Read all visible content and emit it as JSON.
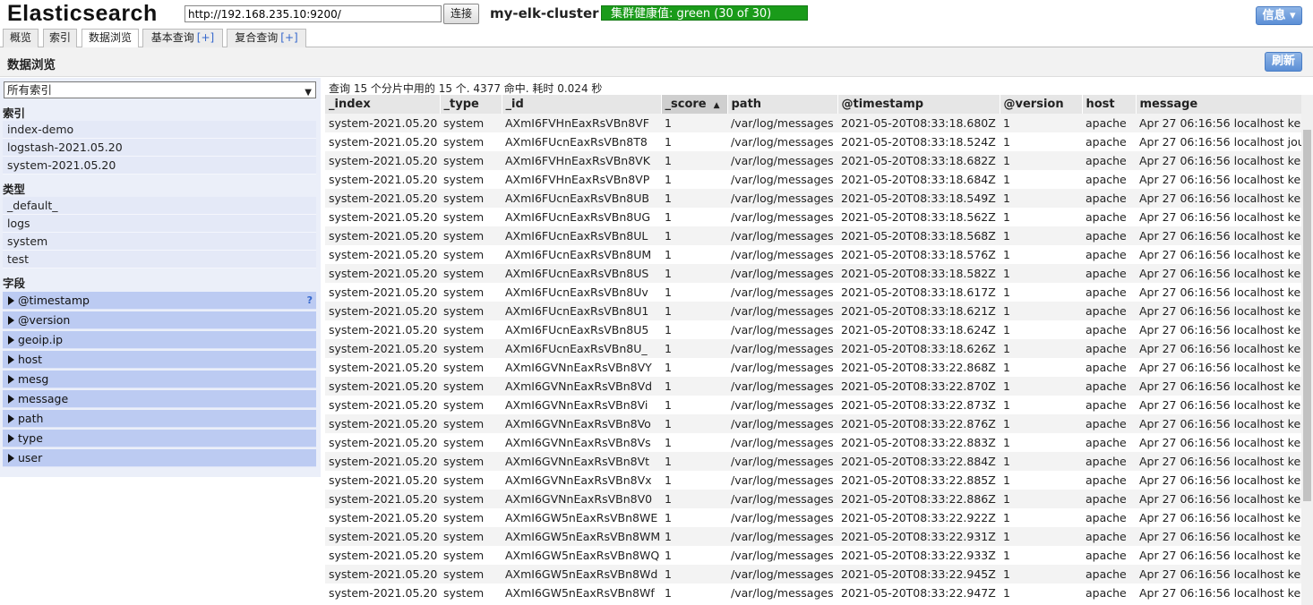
{
  "header": {
    "logo": "Elasticsearch",
    "url_value": "http://192.168.235.10:9200/",
    "connect_label": "连接",
    "cluster_name": "my-elk-cluster",
    "health_text": "集群健康值: green (30 of 30)",
    "health_color": "#1a9b1a",
    "info_label": "信息 ▾"
  },
  "tabs": [
    {
      "label": "概览",
      "plus": ""
    },
    {
      "label": "索引",
      "plus": ""
    },
    {
      "label": "数据浏览",
      "plus": "",
      "active": true
    },
    {
      "label": "基本查询",
      "plus": "[+]"
    },
    {
      "label": "复合查询",
      "plus": "[+]"
    }
  ],
  "section": {
    "title": "数据浏览",
    "refresh_label": "刷新"
  },
  "sidebar": {
    "index_select": "所有索引",
    "indices_heading": "索引",
    "indices": [
      "index-demo",
      "logstash-2021.05.20",
      "system-2021.05.20"
    ],
    "types_heading": "类型",
    "types": [
      "_default_",
      "logs",
      "system",
      "test"
    ],
    "fields_heading": "字段",
    "fields": [
      "@timestamp",
      "@version",
      "geoip.ip",
      "host",
      "mesg",
      "message",
      "path",
      "type",
      "user"
    ],
    "help_mark": "?"
  },
  "results": {
    "summary": "查询 15 个分片中用的 15 个. 4377 命中. 耗时 0.024 秒",
    "columns": [
      "_index",
      "_type",
      "_id",
      "_score",
      "path",
      "@timestamp",
      "@version",
      "host",
      "message"
    ],
    "sort_indicator": "▲",
    "rows": [
      [
        "system-2021.05.20",
        "system",
        "AXmI6FVHnEaxRsVBn8VF",
        "1",
        "/var/log/messages",
        "2021-05-20T08:33:18.680Z",
        "1",
        "apache",
        "Apr 27 06:16:56 localhost ke"
      ],
      [
        "system-2021.05.20",
        "system",
        "AXmI6FUcnEaxRsVBn8T8",
        "1",
        "/var/log/messages",
        "2021-05-20T08:33:18.524Z",
        "1",
        "apache",
        "Apr 27 06:16:56 localhost jou"
      ],
      [
        "system-2021.05.20",
        "system",
        "AXmI6FVHnEaxRsVBn8VK",
        "1",
        "/var/log/messages",
        "2021-05-20T08:33:18.682Z",
        "1",
        "apache",
        "Apr 27 06:16:56 localhost ke"
      ],
      [
        "system-2021.05.20",
        "system",
        "AXmI6FVHnEaxRsVBn8VP",
        "1",
        "/var/log/messages",
        "2021-05-20T08:33:18.684Z",
        "1",
        "apache",
        "Apr 27 06:16:56 localhost ke"
      ],
      [
        "system-2021.05.20",
        "system",
        "AXmI6FUcnEaxRsVBn8UB",
        "1",
        "/var/log/messages",
        "2021-05-20T08:33:18.549Z",
        "1",
        "apache",
        "Apr 27 06:16:56 localhost ke"
      ],
      [
        "system-2021.05.20",
        "system",
        "AXmI6FUcnEaxRsVBn8UG",
        "1",
        "/var/log/messages",
        "2021-05-20T08:33:18.562Z",
        "1",
        "apache",
        "Apr 27 06:16:56 localhost ke"
      ],
      [
        "system-2021.05.20",
        "system",
        "AXmI6FUcnEaxRsVBn8UL",
        "1",
        "/var/log/messages",
        "2021-05-20T08:33:18.568Z",
        "1",
        "apache",
        "Apr 27 06:16:56 localhost ke"
      ],
      [
        "system-2021.05.20",
        "system",
        "AXmI6FUcnEaxRsVBn8UM",
        "1",
        "/var/log/messages",
        "2021-05-20T08:33:18.576Z",
        "1",
        "apache",
        "Apr 27 06:16:56 localhost ke"
      ],
      [
        "system-2021.05.20",
        "system",
        "AXmI6FUcnEaxRsVBn8US",
        "1",
        "/var/log/messages",
        "2021-05-20T08:33:18.582Z",
        "1",
        "apache",
        "Apr 27 06:16:56 localhost ke"
      ],
      [
        "system-2021.05.20",
        "system",
        "AXmI6FUcnEaxRsVBn8Uv",
        "1",
        "/var/log/messages",
        "2021-05-20T08:33:18.617Z",
        "1",
        "apache",
        "Apr 27 06:16:56 localhost ke"
      ],
      [
        "system-2021.05.20",
        "system",
        "AXmI6FUcnEaxRsVBn8U1",
        "1",
        "/var/log/messages",
        "2021-05-20T08:33:18.621Z",
        "1",
        "apache",
        "Apr 27 06:16:56 localhost ke"
      ],
      [
        "system-2021.05.20",
        "system",
        "AXmI6FUcnEaxRsVBn8U5",
        "1",
        "/var/log/messages",
        "2021-05-20T08:33:18.624Z",
        "1",
        "apache",
        "Apr 27 06:16:56 localhost ke"
      ],
      [
        "system-2021.05.20",
        "system",
        "AXmI6FUcnEaxRsVBn8U_",
        "1",
        "/var/log/messages",
        "2021-05-20T08:33:18.626Z",
        "1",
        "apache",
        "Apr 27 06:16:56 localhost ke"
      ],
      [
        "system-2021.05.20",
        "system",
        "AXmI6GVNnEaxRsVBn8VY",
        "1",
        "/var/log/messages",
        "2021-05-20T08:33:22.868Z",
        "1",
        "apache",
        "Apr 27 06:16:56 localhost ke"
      ],
      [
        "system-2021.05.20",
        "system",
        "AXmI6GVNnEaxRsVBn8Vd",
        "1",
        "/var/log/messages",
        "2021-05-20T08:33:22.870Z",
        "1",
        "apache",
        "Apr 27 06:16:56 localhost ke"
      ],
      [
        "system-2021.05.20",
        "system",
        "AXmI6GVNnEaxRsVBn8Vi",
        "1",
        "/var/log/messages",
        "2021-05-20T08:33:22.873Z",
        "1",
        "apache",
        "Apr 27 06:16:56 localhost ke"
      ],
      [
        "system-2021.05.20",
        "system",
        "AXmI6GVNnEaxRsVBn8Vo",
        "1",
        "/var/log/messages",
        "2021-05-20T08:33:22.876Z",
        "1",
        "apache",
        "Apr 27 06:16:56 localhost ke"
      ],
      [
        "system-2021.05.20",
        "system",
        "AXmI6GVNnEaxRsVBn8Vs",
        "1",
        "/var/log/messages",
        "2021-05-20T08:33:22.883Z",
        "1",
        "apache",
        "Apr 27 06:16:56 localhost ke"
      ],
      [
        "system-2021.05.20",
        "system",
        "AXmI6GVNnEaxRsVBn8Vt",
        "1",
        "/var/log/messages",
        "2021-05-20T08:33:22.884Z",
        "1",
        "apache",
        "Apr 27 06:16:56 localhost ke"
      ],
      [
        "system-2021.05.20",
        "system",
        "AXmI6GVNnEaxRsVBn8Vx",
        "1",
        "/var/log/messages",
        "2021-05-20T08:33:22.885Z",
        "1",
        "apache",
        "Apr 27 06:16:56 localhost ke"
      ],
      [
        "system-2021.05.20",
        "system",
        "AXmI6GVNnEaxRsVBn8V0",
        "1",
        "/var/log/messages",
        "2021-05-20T08:33:22.886Z",
        "1",
        "apache",
        "Apr 27 06:16:56 localhost ke"
      ],
      [
        "system-2021.05.20",
        "system",
        "AXmI6GW5nEaxRsVBn8WE",
        "1",
        "/var/log/messages",
        "2021-05-20T08:33:22.922Z",
        "1",
        "apache",
        "Apr 27 06:16:56 localhost ke"
      ],
      [
        "system-2021.05.20",
        "system",
        "AXmI6GW5nEaxRsVBn8WM",
        "1",
        "/var/log/messages",
        "2021-05-20T08:33:22.931Z",
        "1",
        "apache",
        "Apr 27 06:16:56 localhost ke"
      ],
      [
        "system-2021.05.20",
        "system",
        "AXmI6GW5nEaxRsVBn8WQ",
        "1",
        "/var/log/messages",
        "2021-05-20T08:33:22.933Z",
        "1",
        "apache",
        "Apr 27 06:16:56 localhost ke"
      ],
      [
        "system-2021.05.20",
        "system",
        "AXmI6GW5nEaxRsVBn8Wd",
        "1",
        "/var/log/messages",
        "2021-05-20T08:33:22.945Z",
        "1",
        "apache",
        "Apr 27 06:16:56 localhost ke"
      ],
      [
        "system-2021.05.20",
        "system",
        "AXmI6GW5nEaxRsVBn8Wf",
        "1",
        "/var/log/messages",
        "2021-05-20T08:33:22.947Z",
        "1",
        "apache",
        "Apr 27 06:16:56 localhost ke"
      ]
    ]
  }
}
